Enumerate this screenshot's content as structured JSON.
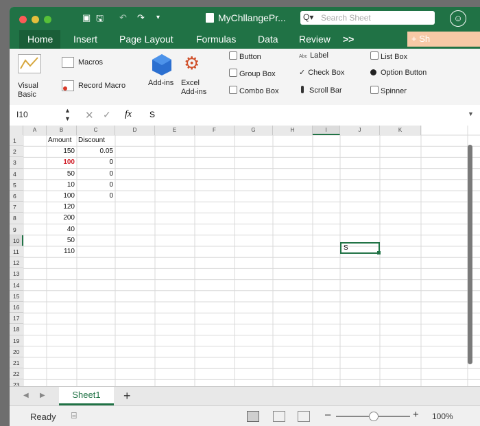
{
  "window": {
    "title": "MyChllangePr...",
    "search_placeholder": "Search Sheet"
  },
  "tabs": [
    "Home",
    "Insert",
    "Page Layout",
    "Formulas",
    "Data",
    "Review",
    ">>"
  ],
  "share_label": "+ Sh",
  "ribbon": {
    "visual_basic": "Visual Basic",
    "macros": "Macros",
    "record_macro": "Record Macro",
    "addins": "Add-ins",
    "excel_addins": "Excel Add-ins",
    "button": "Button",
    "group_box": "Group Box",
    "combo_box": "Combo Box",
    "label": "Label",
    "check_box": "Check Box",
    "scroll_bar": "Scroll Bar",
    "list_box": "List Box",
    "option_button": "Option Button",
    "spinner": "Spinner"
  },
  "formula_bar": {
    "name_box": "I10",
    "fx": "fx",
    "value": "S"
  },
  "columns": [
    "A",
    "B",
    "C",
    "D",
    "E",
    "F",
    "G",
    "H",
    "I",
    "J",
    "K"
  ],
  "rows": [
    "1",
    "2",
    "3",
    "4",
    "5",
    "6",
    "7",
    "8",
    "9",
    "10",
    "11",
    "12",
    "13",
    "14",
    "15",
    "16",
    "17",
    "18",
    "19",
    "20",
    "21",
    "22",
    "23"
  ],
  "cells": {
    "B1": "Amount",
    "C1": "Discount",
    "B2": "150",
    "C2": "0.05",
    "B3": "100",
    "C3": "0",
    "B4": "50",
    "C4": "0",
    "B5": "10",
    "C5": "0",
    "B6": "100",
    "C6": "0",
    "B7": "120",
    "B8": "200",
    "B9": "40",
    "B10": "50",
    "B11": "110",
    "I10": "S"
  },
  "sheet_tabs": [
    "Sheet1"
  ],
  "status": {
    "ready": "Ready",
    "zoom": "100%",
    "zoom_level": 1.0
  },
  "colors": {
    "green": "#207245",
    "red_value": "#d0202a",
    "selection": "#217346"
  }
}
